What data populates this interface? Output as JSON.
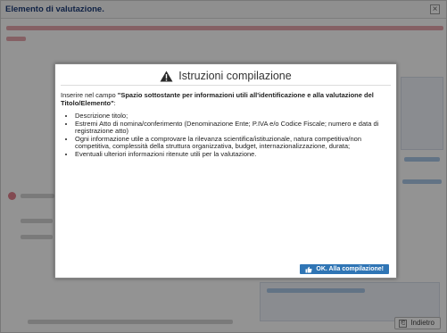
{
  "window": {
    "title": "Elemento di valutazione.",
    "close_symbol": "×",
    "back_label": "Indietro"
  },
  "dialog": {
    "title": "Istruzioni compilazione",
    "intro_prefix": "Inserire nel campo ",
    "intro_bold": "\"Spazio sottostante per informazioni utili all'identificazione e alla valutazione del Titolo/Elemento\"",
    "intro_suffix": ":",
    "items": [
      "Descrizione titolo;",
      "Estremi Atto di nomina/conferimento (Denominazione Ente; P.IVA e/o Codice Fiscale; numero e data di registrazione atto)",
      "Ogni informazione utile a comprovare la rilevanza scientifica/istituzionale, natura competitiva/non competitiva, complessità della struttura organizzativa, budget, internazionalizzazione, durata;",
      "Eventuali ulteriori informazioni ritenute utili per la valutazione."
    ],
    "ok_label": "OK. Alla compilazione!"
  },
  "icons": {
    "warning": "warning-triangle-icon",
    "ok": "thumbs-up-icon",
    "back": "back-icon",
    "close": "close-icon"
  },
  "colors": {
    "title_blue": "#1d3c78",
    "button_blue": "#2f75b5",
    "warning": "#222222"
  }
}
